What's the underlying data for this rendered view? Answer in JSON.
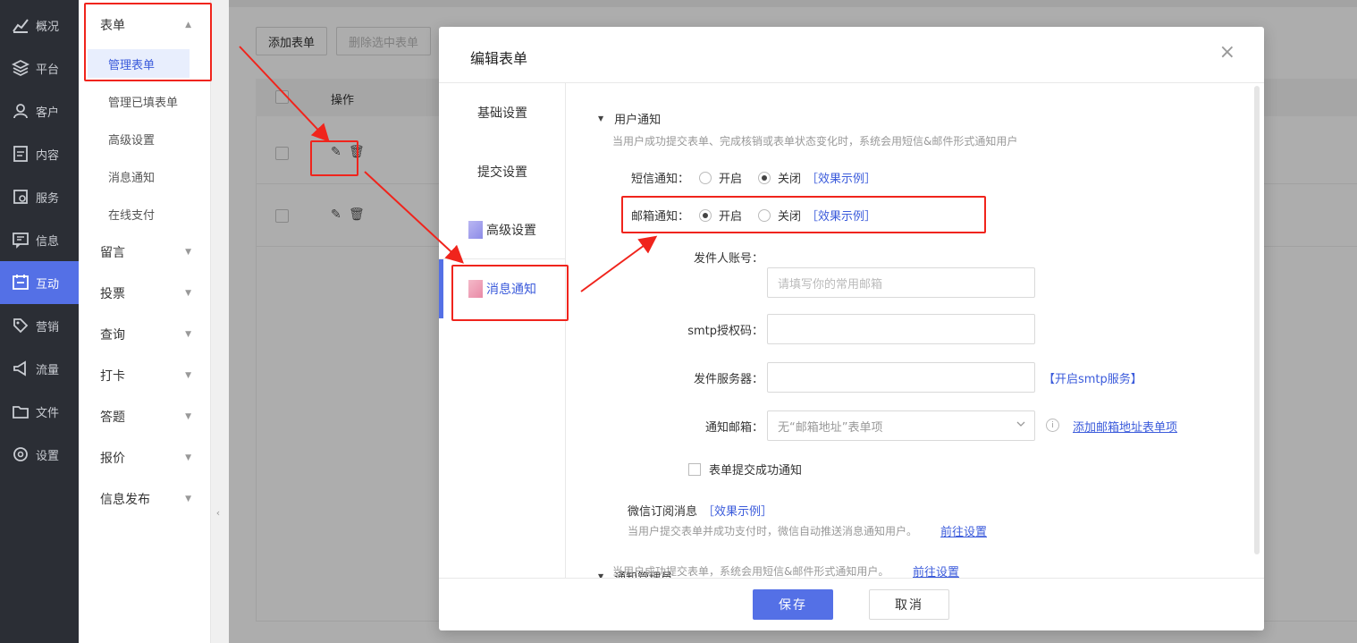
{
  "nav": {
    "items": [
      {
        "label": "概况",
        "icon": "chart-trend-icon"
      },
      {
        "label": "平台",
        "icon": "layers-icon"
      },
      {
        "label": "客户",
        "icon": "user-icon"
      },
      {
        "label": "内容",
        "icon": "document-icon"
      },
      {
        "label": "服务",
        "icon": "service-icon"
      },
      {
        "label": "信息",
        "icon": "message-icon"
      },
      {
        "label": "互动",
        "icon": "interaction-icon",
        "active": true
      },
      {
        "label": "营销",
        "icon": "tag-icon"
      },
      {
        "label": "流量",
        "icon": "megaphone-icon"
      },
      {
        "label": "文件",
        "icon": "folder-icon"
      },
      {
        "label": "设置",
        "icon": "gear-icon"
      }
    ]
  },
  "subnav": {
    "form_group": "表单",
    "form_children": [
      "管理表单",
      "管理已填表单",
      "高级设置",
      "消息通知",
      "在线支付"
    ],
    "groups": [
      "留言",
      "投票",
      "查询",
      "打卡",
      "答题",
      "报价",
      "信息发布"
    ]
  },
  "main": {
    "add_button": "添加表单",
    "delete_button": "删除选中表单",
    "col_action": "操作"
  },
  "modal": {
    "title": "编辑表单",
    "close": "×",
    "tabs": [
      "基础设置",
      "提交设置",
      "高级设置",
      "消息通知"
    ],
    "user_notify": {
      "title": "用户通知",
      "desc": "当用户成功提交表单、完成核销或表单状态变化时，系统会用短信&邮件形式通知用户",
      "sms_label": "短信通知：",
      "email_label": "邮箱通知：",
      "on": "开启",
      "off": "关闭",
      "example": "［效果示例］",
      "sender_label": "发件人账号：",
      "sender_placeholder": "请填写你的常用邮箱",
      "smtp_label": "smtp授权码：",
      "server_label": "发件服务器：",
      "smtp_link": "【开启smtp服务】",
      "notify_email_label": "通知邮箱：",
      "notify_email_value": "无“邮箱地址”表单项",
      "add_email_link": "添加邮箱地址表单项",
      "submit_success": "表单提交成功通知",
      "wechat_title": "微信订阅消息",
      "wechat_example": "［效果示例］",
      "wechat_desc": "当用户提交表单并成功支付时，微信自动推送消息通知用户。",
      "goto": "前往设置"
    },
    "admin_notify": {
      "title": "通知管理员",
      "desc": "当用户成功提交表单，系统会用短信&邮件形式通知用户。",
      "goto": "前往设置"
    },
    "save": "保存",
    "cancel": "取消"
  },
  "colors": {
    "accent": "#5470e6",
    "annotation": "#f0241c",
    "nav_bg": "#2b2e35"
  }
}
